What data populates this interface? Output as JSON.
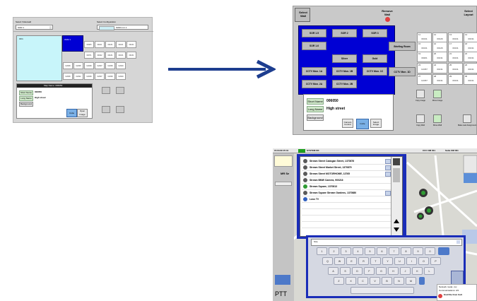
{
  "screen1": {
    "select_videowall_label": "Select Videowall",
    "select_videowall_value": "SOR 1",
    "select_config_label": "Select Configuration",
    "select_config_value": "SOR1 LC 1",
    "preview_label": "OF1",
    "selected_cell_label": "OM2 1",
    "cells": [
      [
        "00305",
        "00101",
        "00131",
        "00131",
        "00131"
      ],
      [
        "00371",
        "00322",
        "00131",
        "00131",
        "00131"
      ],
      [
        "C2006",
        "C2005",
        "C2006",
        "C2007",
        "C2006",
        "C2020"
      ],
      [
        "C2006",
        "C2042",
        "C2006",
        "C2007",
        "C2006",
        "C2020"
      ]
    ],
    "panel_title": "Map Name: 006050",
    "short_name_label": "Short Name",
    "short_name_value": "006050",
    "long_name_label": "Long Name",
    "long_name_value": "High street",
    "background_label": "Background",
    "btn_a": "Invite",
    "btn_b": "Open Image"
  },
  "screen2": {
    "select_wall": "Select Wall",
    "remove_wall": "Remove Wall",
    "select_layout": "Select Layout",
    "groups": [
      "SOR 1.5",
      "SOR 2",
      "SOR 3",
      "SOR 1.6",
      "Briefing Room",
      "Silver",
      "Gold",
      "CCTV Mon. 1A",
      "CCTV Mon. 1B",
      "CCTV Mon. 1C",
      "CCTV Mon. 1D",
      "CCTV Mon. 2A",
      "CCTV Mon. 2B"
    ],
    "cells": [
      {
        "n": "11",
        "v": "00131"
      },
      {
        "n": "12",
        "v": "00126"
      },
      {
        "n": "13",
        "v": "00131"
      },
      {
        "n": "14",
        "v": "00131"
      },
      {
        "n": "15",
        "v": "00131"
      },
      {
        "n": "16",
        "v": "00126"
      },
      {
        "n": "17",
        "v": "00131"
      },
      {
        "n": "18",
        "v": "00131"
      },
      {
        "n": "19",
        "v": "00201"
      },
      {
        "n": "20",
        "v": "00131"
      },
      {
        "n": "21",
        "v": "00131"
      },
      {
        "n": "22",
        "v": "00131"
      },
      {
        "n": "23",
        "v": "C2457"
      },
      {
        "n": "24",
        "v": "00131"
      },
      {
        "n": "25",
        "v": "00131"
      },
      {
        "n": "26",
        "v": "00131"
      },
      {
        "n": "27",
        "v": "C2457"
      },
      {
        "n": "28",
        "v": "00131"
      },
      {
        "n": "29",
        "v": "00131"
      },
      {
        "n": "30",
        "v": "00131"
      }
    ],
    "short_name_label": "Short Name",
    "short_name_value": "006050",
    "long_name_label": "Long Name",
    "long_name_value": "High street",
    "background_label": "Background",
    "camera_control": "Camera Control",
    "invite": "Invite",
    "select_image": "Select Image",
    "tools": [
      "Copy Image",
      "Move Image",
      "Copy Wall",
      "Move Wall",
      "Make Last Assignment"
    ]
  },
  "screen3": {
    "top_left_time": "15.04.09 15:41",
    "top_status": "SYSTEM OK",
    "top_right_a": "CCC OM 001",
    "top_right_b": "Suite OM 001",
    "side_label": "MR Se",
    "ptt": "PTT",
    "list_items": [
      "Stream Street Cadogan Street, 1370876",
      "Stream Street Market Street, 1370879",
      "Stream Street MOTORHOME, 13765",
      "Stream BMW Camera, 900216",
      "Stream Square, 1370813",
      "Stream Square Stream Gardens, 1370880",
      "Loss TV"
    ],
    "search_value": "Stre",
    "keyboard_rows": [
      [
        "1",
        "2",
        "3",
        "4",
        "5",
        "6",
        "7",
        "8",
        "9",
        "0"
      ],
      [
        "Q",
        "W",
        "E",
        "R",
        "T",
        "Y",
        "U",
        "I",
        "O",
        "P"
      ],
      [
        "A",
        "S",
        "D",
        "F",
        "G",
        "H",
        "J",
        "K",
        "L"
      ],
      [
        "Z",
        "X",
        "C",
        "V",
        "B",
        "N",
        "M"
      ]
    ],
    "bottom_note_a": "Network mode: xxx",
    "bottom_note_b": "Communications: 2/2",
    "bottom_note_c": "End File from Cult"
  }
}
